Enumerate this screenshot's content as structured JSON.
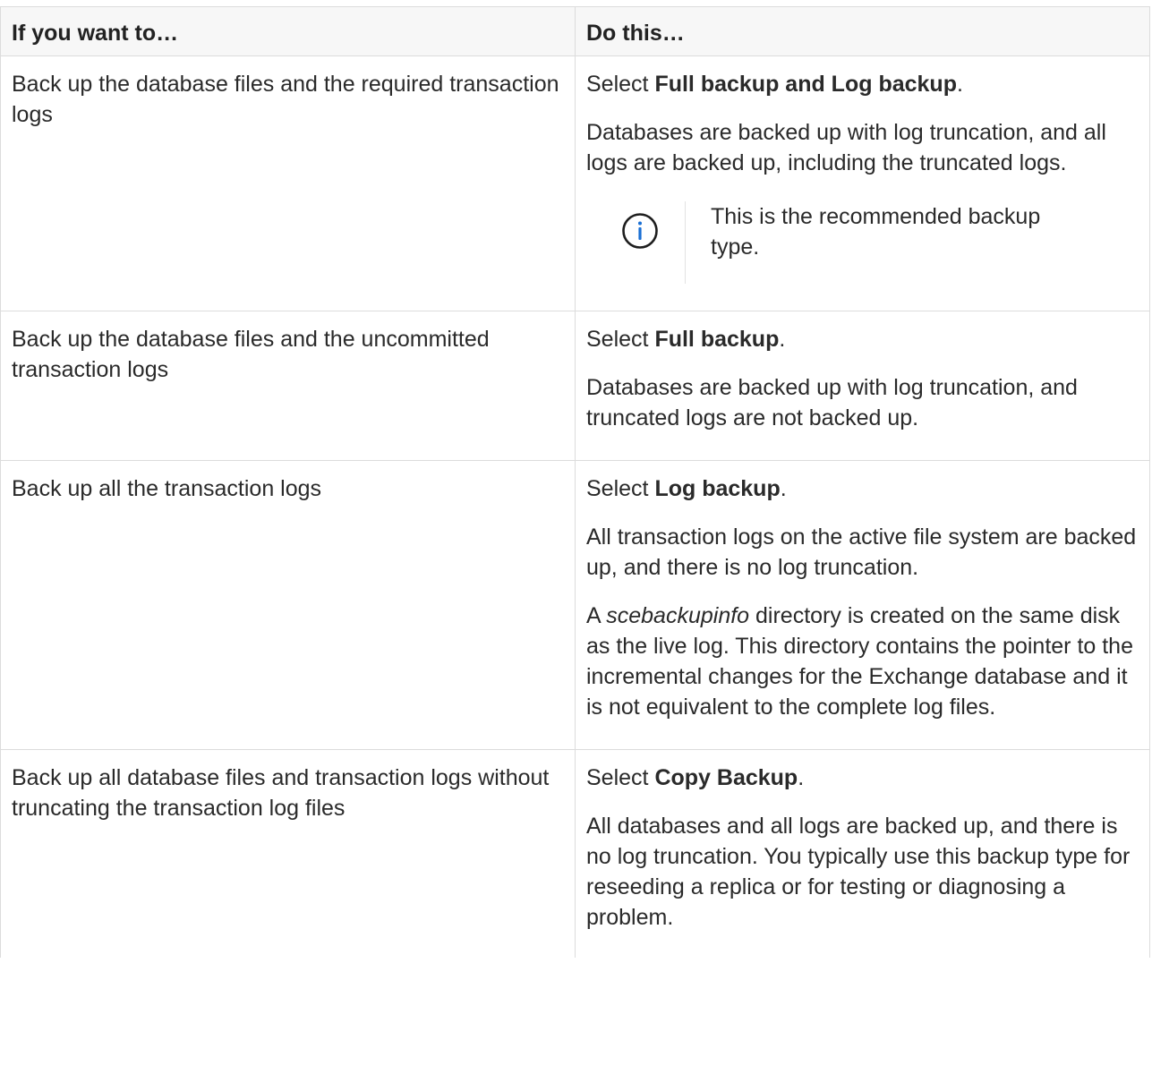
{
  "table": {
    "headers": [
      "If you want to…",
      "Do this…"
    ],
    "rows": [
      {
        "want": "Back up the database files and the required transaction logs",
        "select_prefix": "Select ",
        "select_bold": "Full backup and Log backup",
        "select_suffix": ".",
        "description": "Databases are backed up with log truncation, and all logs are backed up, including the truncated logs.",
        "note": "This is the recommended backup type."
      },
      {
        "want": "Back up the database files and the uncommitted transaction logs",
        "select_prefix": "Select ",
        "select_bold": "Full backup",
        "select_suffix": ".",
        "description": "Databases are backed up with log truncation, and truncated logs are not backed up."
      },
      {
        "want": "Back up all the transaction logs",
        "select_prefix": "Select ",
        "select_bold": "Log backup",
        "select_suffix": ".",
        "description": "All transaction logs on the active file system are backed up, and there is no log truncation.",
        "extra_prefix": "A ",
        "extra_italic": "scebackupinfo",
        "extra_suffix": " directory is created on the same disk as the live log. This directory contains the pointer to the incremental changes for the Exchange database and it is not equivalent to the complete log files."
      },
      {
        "want": "Back up all database files and transaction logs without truncating the transaction log files",
        "select_prefix": "Select ",
        "select_bold": "Copy Backup",
        "select_suffix": ".",
        "description": "All databases and all logs are backed up, and there is no log truncation. You typically use this backup type for reseeding a replica or for testing or diagnosing a problem."
      }
    ]
  },
  "colors": {
    "border": "#dcdcdc",
    "header_bg": "#f7f7f7",
    "text": "#2a2a2a",
    "info_icon": "#1a6fd4"
  },
  "icons": {
    "note": "info-icon"
  }
}
